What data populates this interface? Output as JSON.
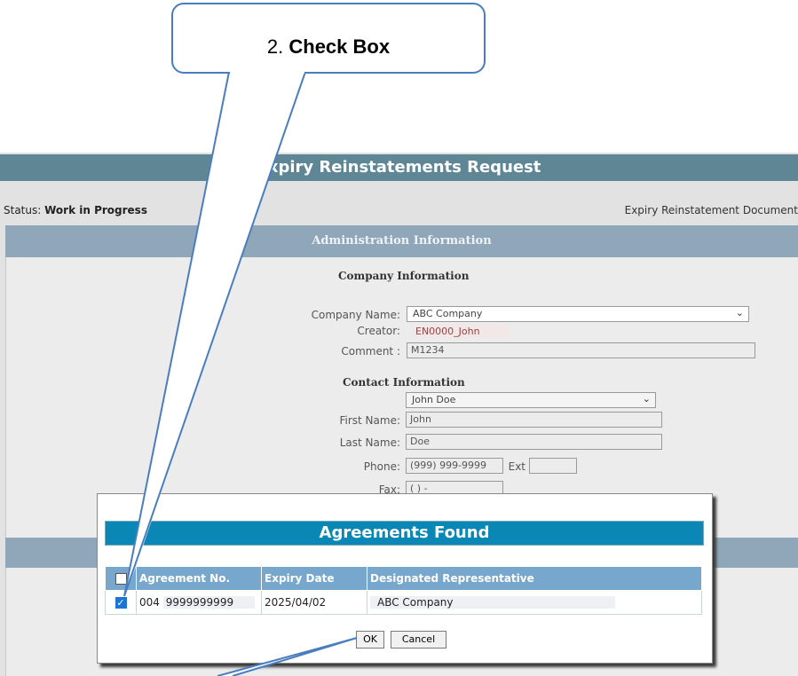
{
  "page": {
    "title": "Expiry Reinstatements Request",
    "status_prefix": "Status:",
    "status_value": "Work in Progress",
    "document_label": "Expiry Reinstatement Document",
    "section_title": "Administration Information"
  },
  "company_info": {
    "heading": "Company Information",
    "company_name_label": "Company Name:",
    "company_name_value": "ABC Company",
    "creator_label": "Creator:",
    "creator_value": "EN0000_John",
    "comment_label": "Comment :",
    "comment_value": "M1234"
  },
  "contact_info": {
    "heading": "Contact Information",
    "contact_select_value": "John Doe",
    "first_name_label": "First Name:",
    "first_name_value": "John",
    "last_name_label": "Last Name:",
    "last_name_value": "Doe",
    "phone_label": "Phone:",
    "phone_value": "(999) 999-9999",
    "ext_label": "Ext",
    "ext_value": "",
    "fax_label": "Fax:",
    "fax_value": "(   )     -"
  },
  "dialog": {
    "title": "Agreements Found",
    "columns": [
      "Agreement No.",
      "Expiry Date",
      "Designated Representative"
    ],
    "rows": [
      {
        "prefix": "004",
        "agreement_no": "9999999999",
        "expiry_date": "2025/04/02",
        "representative": "ABC Company",
        "checked": true
      }
    ],
    "ok_label": "OK",
    "cancel_label": "Cancel"
  },
  "callout": {
    "number": "2.",
    "text": "Check Box"
  },
  "colors": {
    "title_bar": "#5e8695",
    "section_bar": "#8fa7b9",
    "dialog_title": "#0a87b5",
    "table_header": "#77a7cc",
    "callout_border": "#4a7dc0",
    "checkbox_checked": "#1b74d6"
  }
}
